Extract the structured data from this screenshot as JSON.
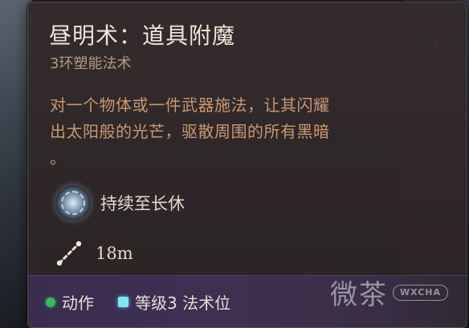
{
  "spell": {
    "name": "昼明术：道具附魔",
    "level_school": "3环塑能法术",
    "description_lines": [
      "对一个物体或一件武器施法，让其闪耀",
      "出太阳般的光芒，驱散周围的所有黑暗",
      "。"
    ],
    "duration": "持续至长休",
    "duration_icon": "long-rest-icon",
    "range": "18m",
    "range_icon": "range-icon"
  },
  "footer": {
    "action_label": "动作",
    "action_color": "#2fbf52",
    "spell_slot_label": "等级3 法术位",
    "spell_slot_color": "#7ee7f4"
  },
  "watermark": {
    "text": "微茶",
    "badge": "WXCHA"
  },
  "colors": {
    "tooltip_background": "#332a2b",
    "title": "#f0e6da",
    "subtitle": "#b39a84",
    "description": "#c99870",
    "footer_background": "#3d2f50"
  }
}
